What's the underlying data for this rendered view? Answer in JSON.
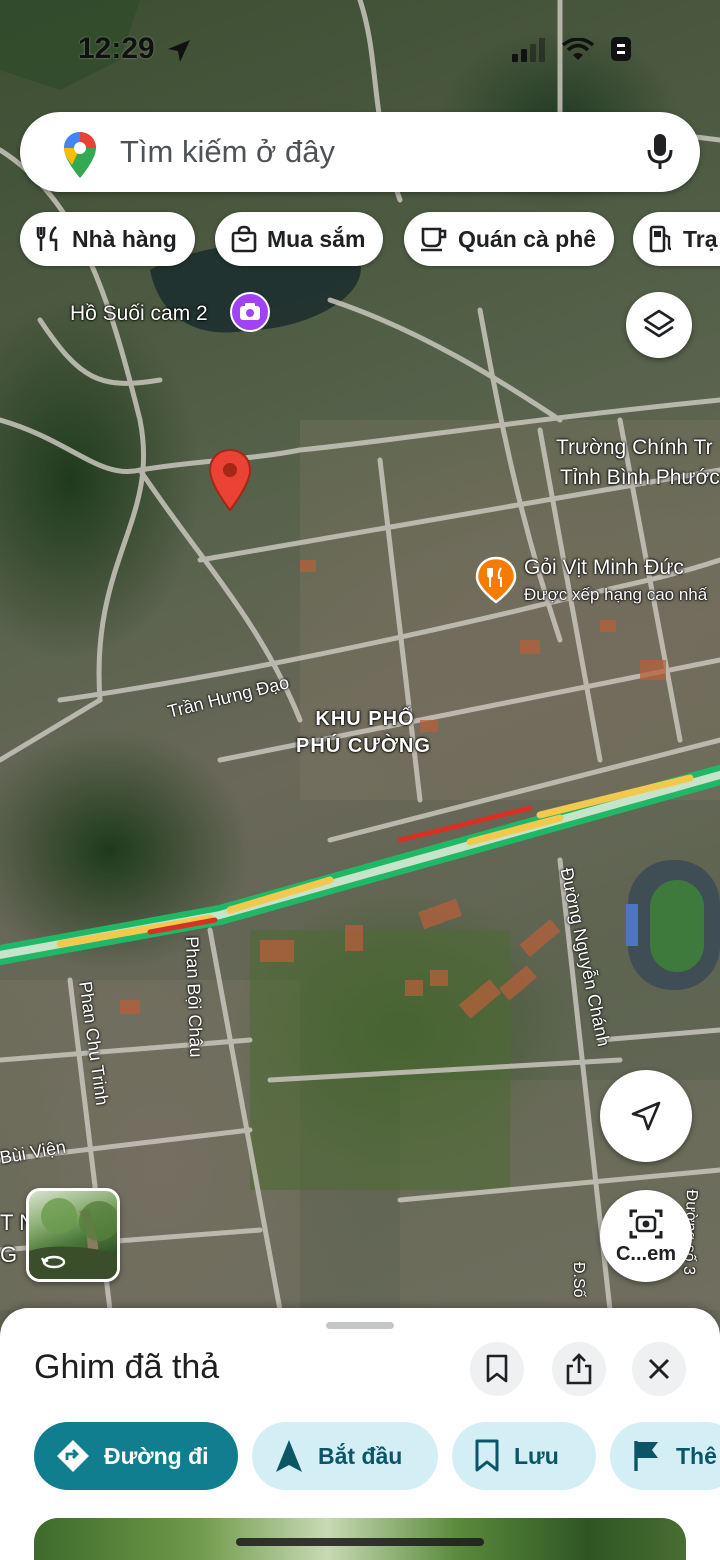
{
  "status_bar": {
    "time": "12:29"
  },
  "search": {
    "placeholder": "Tìm kiếm ở đây"
  },
  "chips": [
    {
      "label": "Nhà hàng",
      "icon": "restaurant-icon"
    },
    {
      "label": "Mua sắm",
      "icon": "shopping-bag-icon"
    },
    {
      "label": "Quán cà phê",
      "icon": "coffee-icon"
    },
    {
      "label": "Trạ",
      "icon": "gas-station-icon"
    }
  ],
  "map": {
    "labels": {
      "lake": "Hồ Suối cam 2",
      "school_line1": "Trường Chính Tr",
      "school_line2": "Tỉnh Bình Phước",
      "restaurant_name": "Gỏi Vịt Minh Đức",
      "restaurant_sub": "Được xếp hạng cao nhấ",
      "district_line1": "KHU PHỐ",
      "district_line2": "PHÚ CƯỜNG"
    },
    "roads": {
      "tran_hung_dao": "Trần Hưng Đạo",
      "phan_boi_chau": "Phan Bội Châu",
      "phan_chu_trinh": "Phan Chu Trinh",
      "nguyen_chanh": "Đường Nguyễn Chánh",
      "bui_vien": "Bùi Viện",
      "duong_so": "Đ.Số",
      "duong_so_3": "Đường số 3",
      "edge_tn": "T N",
      "edge_g": "G"
    },
    "colors": {
      "traffic_green": "#1fb866",
      "traffic_yellow": "#f2c94c",
      "traffic_red": "#d93025",
      "pin_red": "#ea4335",
      "food_orange": "#f57c00"
    }
  },
  "lens_button": {
    "label": "C...em"
  },
  "sheet": {
    "title": "Ghim đã thả",
    "actions": [
      {
        "label": "Đường đi",
        "icon": "directions-icon"
      },
      {
        "label": "Bắt đầu",
        "icon": "navigation-arrow-icon"
      },
      {
        "label": "Lưu",
        "icon": "bookmark-icon"
      },
      {
        "label": "Thê",
        "icon": "flag-icon"
      }
    ]
  }
}
